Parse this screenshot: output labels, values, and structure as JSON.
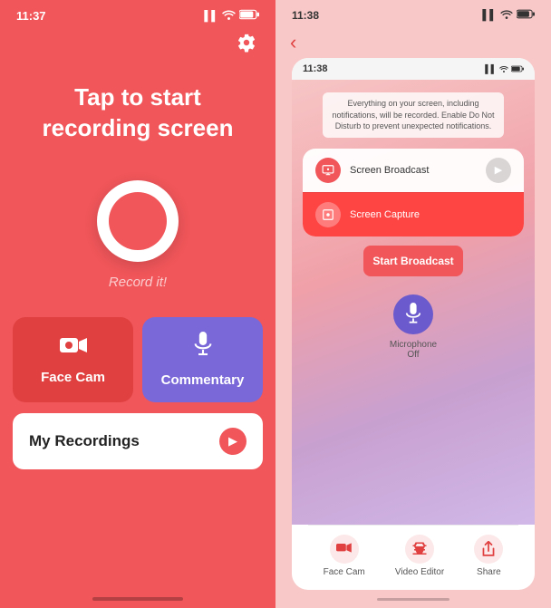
{
  "left_phone": {
    "status_bar": {
      "time": "11:37",
      "signal": "●●",
      "wifi": "wifi",
      "battery": "battery"
    },
    "title_line1": "Tap to start",
    "title_line2": "recording screen",
    "record_label": "Record it!",
    "face_cam_label": "Face Cam",
    "commentary_label": "Commentary",
    "my_recordings_label": "My Recordings"
  },
  "right_phone": {
    "status_bar": {
      "time": "11:38",
      "signal": "●●",
      "battery": "battery"
    },
    "notification_text": "Everything on your screen, including\nnotifications, will be recorded. Enable Do Not\nDisturb to prevent unexpected notifications.",
    "broadcast_item1": "Screen Broadcast",
    "broadcast_item2": "Screen Capture",
    "start_broadcast_label": "Start Broadcast",
    "microphone_label": "Microphone\nOff",
    "nav_face_cam": "Face Cam",
    "nav_video_editor": "Video Editor",
    "nav_share": "Share"
  },
  "colors": {
    "red": "#f0565a",
    "dark_red": "#e04040",
    "purple": "#7b68d8",
    "pink_bg": "#f8c8c8"
  }
}
